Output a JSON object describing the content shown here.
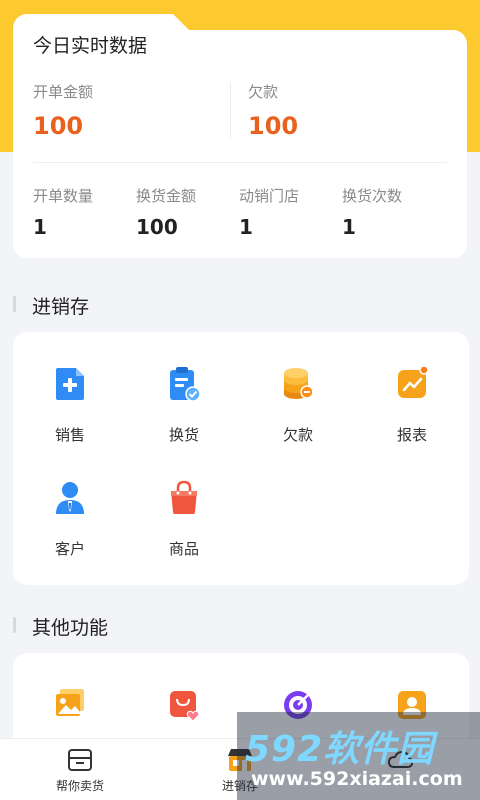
{
  "today": {
    "title": "今日实时数据",
    "order_amount_label": "开单金额",
    "order_amount_value": "100",
    "debt_label": "欠款",
    "debt_value": "100",
    "stats": [
      {
        "label": "开单数量",
        "value": "1"
      },
      {
        "label": "换货金额",
        "value": "100"
      },
      {
        "label": "动销门店",
        "value": "1"
      },
      {
        "label": "换货次数",
        "value": "1"
      }
    ]
  },
  "inventory": {
    "title": "进销存",
    "items": [
      {
        "label": "销售",
        "icon": "sales-doc-icon"
      },
      {
        "label": "换货",
        "icon": "exchange-clipboard-icon"
      },
      {
        "label": "欠款",
        "icon": "coins-icon"
      },
      {
        "label": "报表",
        "icon": "report-chart-icon"
      },
      {
        "label": "客户",
        "icon": "customer-icon"
      },
      {
        "label": "商品",
        "icon": "shopping-bag-icon"
      }
    ]
  },
  "other": {
    "title": "其他功能",
    "items": [
      {
        "icon": "gallery-icon"
      },
      {
        "icon": "shop-heart-icon"
      },
      {
        "icon": "target-icon"
      },
      {
        "icon": "contact-card-icon"
      }
    ]
  },
  "bottom_nav": {
    "items": [
      {
        "label": "帮你卖货",
        "icon": "sell-box-icon"
      },
      {
        "label": "进销存",
        "icon": "store-icon"
      },
      {
        "label": "",
        "icon": ""
      },
      {
        "label": "",
        "icon": "cloud-icon"
      }
    ]
  },
  "watermark": {
    "main": "592软件园",
    "sub": "www.592xiazai.com"
  },
  "colors": {
    "accent_yellow": "#fcc92f",
    "value_orange": "#e8611e",
    "icon_blue": "#2f8cf5",
    "icon_orange": "#f7a21b",
    "icon_red": "#f0563e"
  }
}
